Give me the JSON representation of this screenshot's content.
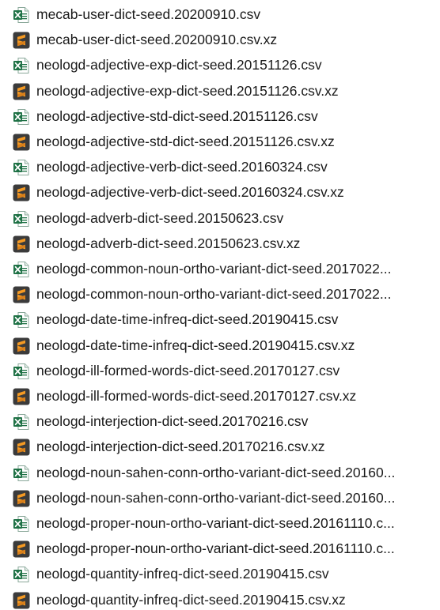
{
  "files": [
    {
      "name": "mecab-user-dict-seed.20200910.csv",
      "type": "excel-csv"
    },
    {
      "name": "mecab-user-dict-seed.20200910.csv.xz",
      "type": "sublime-archive"
    },
    {
      "name": "neologd-adjective-exp-dict-seed.20151126.csv",
      "type": "excel-csv"
    },
    {
      "name": "neologd-adjective-exp-dict-seed.20151126.csv.xz",
      "type": "sublime-archive"
    },
    {
      "name": "neologd-adjective-std-dict-seed.20151126.csv",
      "type": "excel-csv"
    },
    {
      "name": "neologd-adjective-std-dict-seed.20151126.csv.xz",
      "type": "sublime-archive"
    },
    {
      "name": "neologd-adjective-verb-dict-seed.20160324.csv",
      "type": "excel-csv"
    },
    {
      "name": "neologd-adjective-verb-dict-seed.20160324.csv.xz",
      "type": "sublime-archive"
    },
    {
      "name": "neologd-adverb-dict-seed.20150623.csv",
      "type": "excel-csv"
    },
    {
      "name": "neologd-adverb-dict-seed.20150623.csv.xz",
      "type": "sublime-archive"
    },
    {
      "name": "neologd-common-noun-ortho-variant-dict-seed.2017022...",
      "type": "excel-csv"
    },
    {
      "name": "neologd-common-noun-ortho-variant-dict-seed.2017022...",
      "type": "sublime-archive"
    },
    {
      "name": "neologd-date-time-infreq-dict-seed.20190415.csv",
      "type": "excel-csv"
    },
    {
      "name": "neologd-date-time-infreq-dict-seed.20190415.csv.xz",
      "type": "sublime-archive"
    },
    {
      "name": "neologd-ill-formed-words-dict-seed.20170127.csv",
      "type": "excel-csv"
    },
    {
      "name": "neologd-ill-formed-words-dict-seed.20170127.csv.xz",
      "type": "sublime-archive"
    },
    {
      "name": "neologd-interjection-dict-seed.20170216.csv",
      "type": "excel-csv"
    },
    {
      "name": "neologd-interjection-dict-seed.20170216.csv.xz",
      "type": "sublime-archive"
    },
    {
      "name": "neologd-noun-sahen-conn-ortho-variant-dict-seed.20160...",
      "type": "excel-csv"
    },
    {
      "name": "neologd-noun-sahen-conn-ortho-variant-dict-seed.20160...",
      "type": "sublime-archive"
    },
    {
      "name": "neologd-proper-noun-ortho-variant-dict-seed.20161110.c...",
      "type": "excel-csv"
    },
    {
      "name": "neologd-proper-noun-ortho-variant-dict-seed.20161110.c...",
      "type": "sublime-archive"
    },
    {
      "name": "neologd-quantity-infreq-dict-seed.20190415.csv",
      "type": "excel-csv"
    },
    {
      "name": "neologd-quantity-infreq-dict-seed.20190415.csv.xz",
      "type": "sublime-archive"
    }
  ],
  "icons": {
    "excel-csv": {
      "icon": "excel-csv-icon",
      "color": "#1e7145"
    },
    "sublime-archive": {
      "icon": "sublime-text-icon",
      "color": "#f59a23"
    }
  }
}
